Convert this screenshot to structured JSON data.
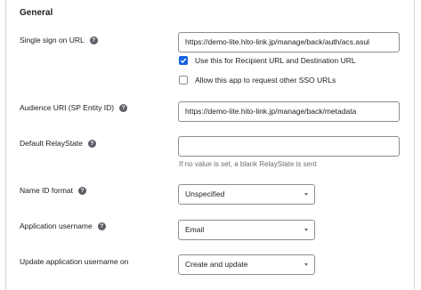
{
  "section": {
    "title": "General"
  },
  "sso_url": {
    "label": "Single sign on URL",
    "help_icon": "question-circle-icon",
    "value": "https://demo-lite.hito-link.jp/manage/back/auth/acs.asul",
    "recipient_checkbox": {
      "label": "Use this for Recipient URL and Destination URL",
      "checked": true
    },
    "other_sso_checkbox": {
      "label": "Allow this app to request other SSO URLs",
      "checked": false
    }
  },
  "audience_uri": {
    "label": "Audience URI (SP Entity ID)",
    "value": "https://demo-lite.hito-link.jp/manage/back/metadata"
  },
  "relay_state": {
    "label": "Default RelayState",
    "value": "",
    "hint": "If no value is set, a blank RelayState is sent"
  },
  "name_id_format": {
    "label": "Name ID format",
    "selected": "Unspecified"
  },
  "app_username": {
    "label": "Application username",
    "selected": "Email"
  },
  "update_username": {
    "label": "Update application username on",
    "selected": "Create and update"
  },
  "colors": {
    "accent": "#1662dd",
    "text": "#1d1d21",
    "muted": "#6e6e78",
    "border": "#8c8c96",
    "help_icon": "#5d5d66"
  }
}
